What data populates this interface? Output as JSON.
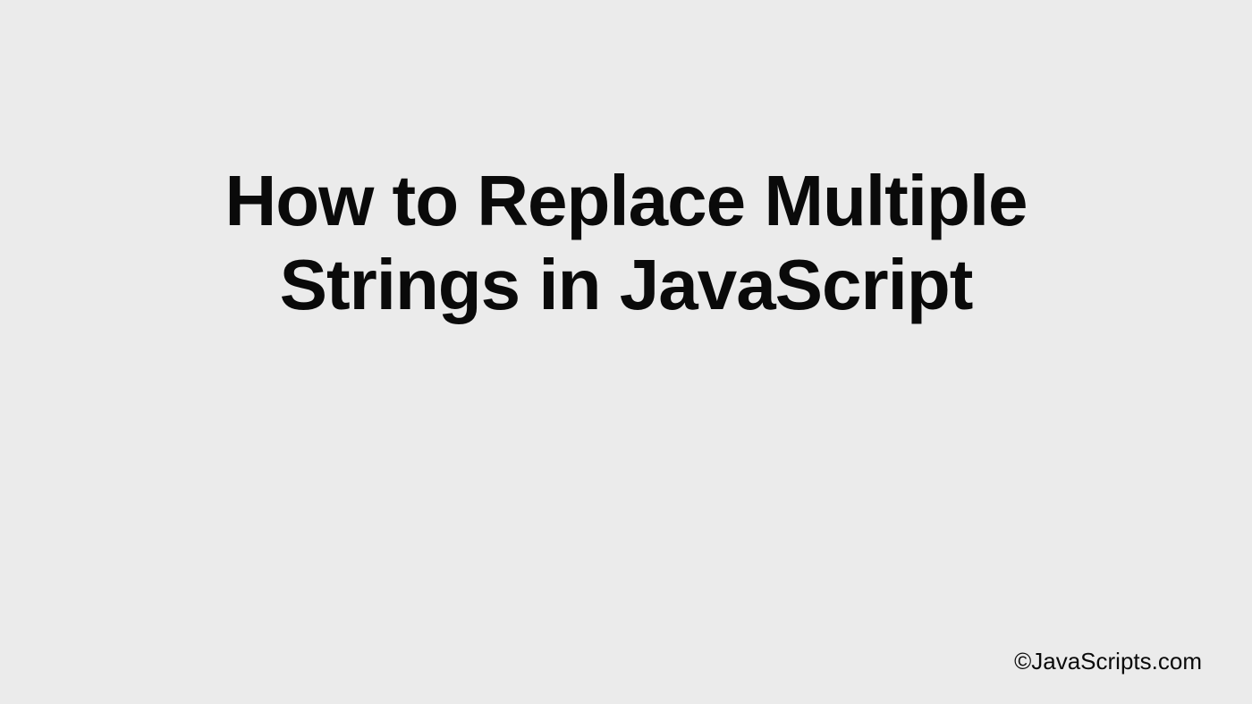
{
  "title": "How to Replace Multiple Strings in JavaScript",
  "footer": "©JavaScripts.com"
}
